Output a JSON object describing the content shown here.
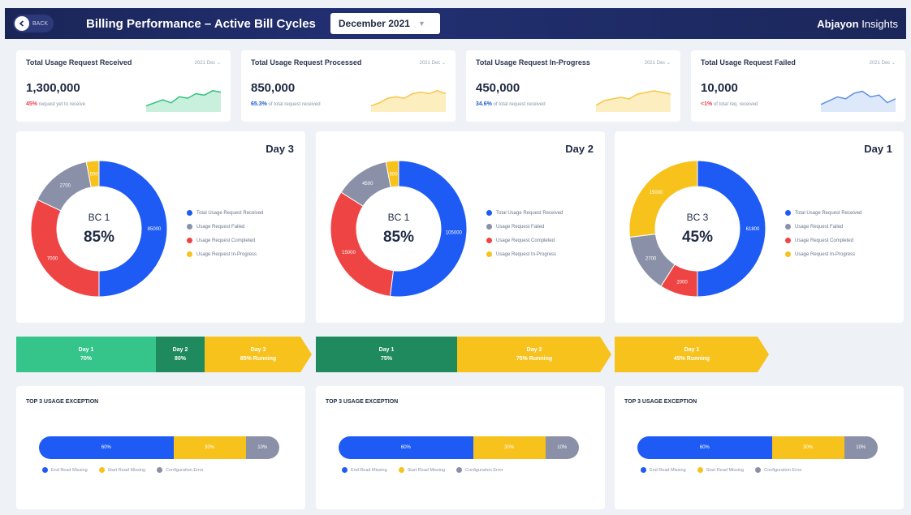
{
  "header": {
    "back_label": "BACK",
    "title": "Billing Performance – Active Bill Cycles",
    "month": "December 2021",
    "brand_bold": "Abjayon",
    "brand_rest": " Insights"
  },
  "kpis": [
    {
      "title": "Total Usage Request Received",
      "filter": "2021 Dec ⌄",
      "value": "1,300,000",
      "pct": "45%",
      "sub": " request yet to receive",
      "pct_color": "#e8414d",
      "line": "#2ec27e",
      "fill": "#c9f0dc",
      "trend": [
        10,
        12,
        14,
        12,
        16,
        15,
        18,
        17,
        20,
        19
      ]
    },
    {
      "title": "Total Usage Request Processed",
      "filter": "2021 Dec ⌄",
      "value": "850,000",
      "pct": "65.3%",
      "sub": " of total request received",
      "pct_color": "#1e5bd8",
      "line": "#f6c746",
      "fill": "#fdeec0",
      "trend": [
        8,
        10,
        13,
        14,
        13,
        16,
        17,
        16,
        18,
        16
      ]
    },
    {
      "title": "Total Usage Request In-Progress",
      "filter": "2021 Dec ⌄",
      "value": "450,000",
      "pct": "34.6%",
      "sub": " of total request received",
      "pct_color": "#1e5bd8",
      "line": "#f6c746",
      "fill": "#fdeec0",
      "trend": [
        8,
        11,
        12,
        13,
        12,
        15,
        16,
        17,
        16,
        15
      ]
    },
    {
      "title": "Total Usage Request Failed",
      "filter": "2021 Dec ⌄",
      "value": "10,000",
      "pct": "<1%",
      "sub": " of total req. received",
      "pct_color": "#e8414d",
      "line": "#5b8ee6",
      "fill": "#dde9fb",
      "trend": [
        10,
        12,
        14,
        13,
        16,
        17,
        14,
        15,
        11,
        13
      ]
    }
  ],
  "donuts": [
    {
      "day": "Day 3",
      "bc": "BC 1",
      "pct": "85%",
      "segments": [
        {
          "label": "85000",
          "value": 50,
          "color": "#1e5bf5"
        },
        {
          "label": "7000",
          "value": 32,
          "color": "#ef4444"
        },
        {
          "label": "2700",
          "value": 15,
          "color": "#8a90a8"
        },
        {
          "label": "500",
          "value": 3,
          "color": "#f7c21b"
        }
      ]
    },
    {
      "day": "Day 2",
      "bc": "BC 1",
      "pct": "85%",
      "segments": [
        {
          "label": "105000",
          "value": 52,
          "color": "#1e5bf5"
        },
        {
          "label": "15000",
          "value": 32,
          "color": "#ef4444"
        },
        {
          "label": "4500",
          "value": 13,
          "color": "#8a90a8"
        },
        {
          "label": "500",
          "value": 3,
          "color": "#f7c21b"
        }
      ]
    },
    {
      "day": "Day 1",
      "bc": "BC 3",
      "pct": "45%",
      "segments": [
        {
          "label": "61800",
          "value": 50,
          "color": "#1e5bf5"
        },
        {
          "label": "2000",
          "value": 9,
          "color": "#ef4444"
        },
        {
          "label": "2700",
          "value": 14,
          "color": "#8a90a8"
        },
        {
          "label": "15000",
          "value": 27,
          "color": "#f7c21b"
        }
      ]
    }
  ],
  "legend": [
    "Total Usage Request Received",
    "Usage Request Failed",
    "Usage Request Completed",
    "Usage Request In-Progress"
  ],
  "progress": [
    [
      {
        "l1": "Day 1",
        "l2": "70%",
        "color": "#35c58a"
      },
      {
        "l1": "Day 2",
        "l2": "80%",
        "color": "#1e8a5e"
      },
      {
        "l1": "Day 3",
        "l2": "85% Running",
        "color": "#f7c21b"
      }
    ],
    [
      {
        "l1": "Day 1",
        "l2": "75%",
        "color": "#1e8a5e"
      },
      {
        "l1": "Day 2",
        "l2": "75% Running",
        "color": "#f7c21b"
      }
    ],
    [
      {
        "l1": "Day 1",
        "l2": "45% Running",
        "color": "#f7c21b"
      }
    ]
  ],
  "exceptions": {
    "title": "TOP 3 USAGE EXCEPTION",
    "legend": [
      "End Read Missing",
      "Start Read Missing",
      "Configuration Error"
    ],
    "bars": [
      [
        {
          "label": "60%",
          "value": 56,
          "color": "#1e5bf5"
        },
        {
          "label": "30%",
          "value": 30,
          "color": "#f7c21b"
        },
        {
          "label": "10%",
          "value": 14,
          "color": "#8a90a8"
        }
      ],
      [
        {
          "label": "60%",
          "value": 56,
          "color": "#1e5bf5"
        },
        {
          "label": "30%",
          "value": 30,
          "color": "#f7c21b"
        },
        {
          "label": "10%",
          "value": 14,
          "color": "#8a90a8"
        }
      ],
      [
        {
          "label": "60%",
          "value": 56,
          "color": "#1e5bf5"
        },
        {
          "label": "30%",
          "value": 30,
          "color": "#f7c21b"
        },
        {
          "label": "10%",
          "value": 14,
          "color": "#8a90a8"
        }
      ]
    ]
  }
}
